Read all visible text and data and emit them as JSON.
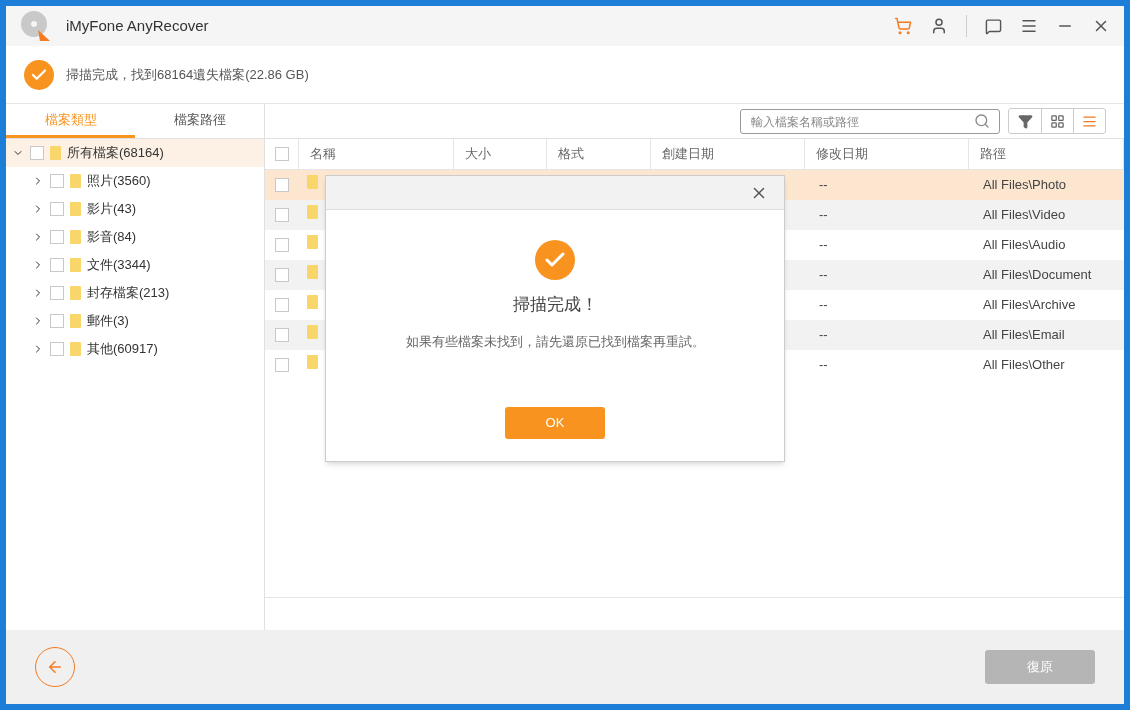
{
  "window": {
    "title": "iMyFone AnyRecover"
  },
  "status": {
    "message": "掃描完成，找到68164遺失檔案(22.86 GB)"
  },
  "sidebar": {
    "tabs": [
      {
        "label": "檔案類型",
        "selected": true
      },
      {
        "label": "檔案路徑",
        "selected": false
      }
    ],
    "tree": [
      {
        "label": "所有檔案(68164)",
        "expanded": true,
        "checked": false,
        "selected": true,
        "children": [
          {
            "label": "照片(3560)",
            "expanded": false,
            "checked": false,
            "selected": false
          },
          {
            "label": "影片(43)",
            "expanded": false,
            "checked": false,
            "selected": false
          },
          {
            "label": "影音(84)",
            "expanded": false,
            "checked": false,
            "selected": false
          },
          {
            "label": "文件(3344)",
            "expanded": false,
            "checked": false,
            "selected": false
          },
          {
            "label": "封存檔案(213)",
            "expanded": false,
            "checked": false,
            "selected": false
          },
          {
            "label": "郵件(3)",
            "expanded": false,
            "checked": false,
            "selected": false
          },
          {
            "label": "其他(60917)",
            "expanded": false,
            "checked": false,
            "selected": false
          }
        ]
      }
    ]
  },
  "search": {
    "placeholder": "輸入檔案名稱或路徑"
  },
  "view_buttons": [
    {
      "kind": "filter",
      "selected": false
    },
    {
      "kind": "grid",
      "selected": false
    },
    {
      "kind": "list",
      "selected": true
    }
  ],
  "table": {
    "select_all": {
      "checked": false
    },
    "columns": [
      "名稱",
      "大小",
      "格式",
      "創建日期",
      "修改日期",
      "路徑"
    ],
    "rows": [
      {
        "modified": "--",
        "path": "All Files\\Photo",
        "checked": false,
        "selected": true
      },
      {
        "modified": "--",
        "path": "All Files\\Video",
        "checked": false,
        "selected": false
      },
      {
        "modified": "--",
        "path": "All Files\\Audio",
        "checked": false,
        "selected": false
      },
      {
        "modified": "--",
        "path": "All Files\\Document",
        "checked": false,
        "selected": false
      },
      {
        "modified": "--",
        "path": "All Files\\Archive",
        "checked": false,
        "selected": false
      },
      {
        "modified": "--",
        "path": "All Files\\Email",
        "checked": false,
        "selected": false
      },
      {
        "modified": "--",
        "path": "All Files\\Other",
        "checked": false,
        "selected": false
      }
    ]
  },
  "dialog": {
    "title": "掃描完成！",
    "message": "如果有些檔案未找到，請先還原已找到檔案再重試。",
    "button": "OK"
  },
  "footer": {
    "recover_button": {
      "label": "復原",
      "disabled": true
    }
  }
}
